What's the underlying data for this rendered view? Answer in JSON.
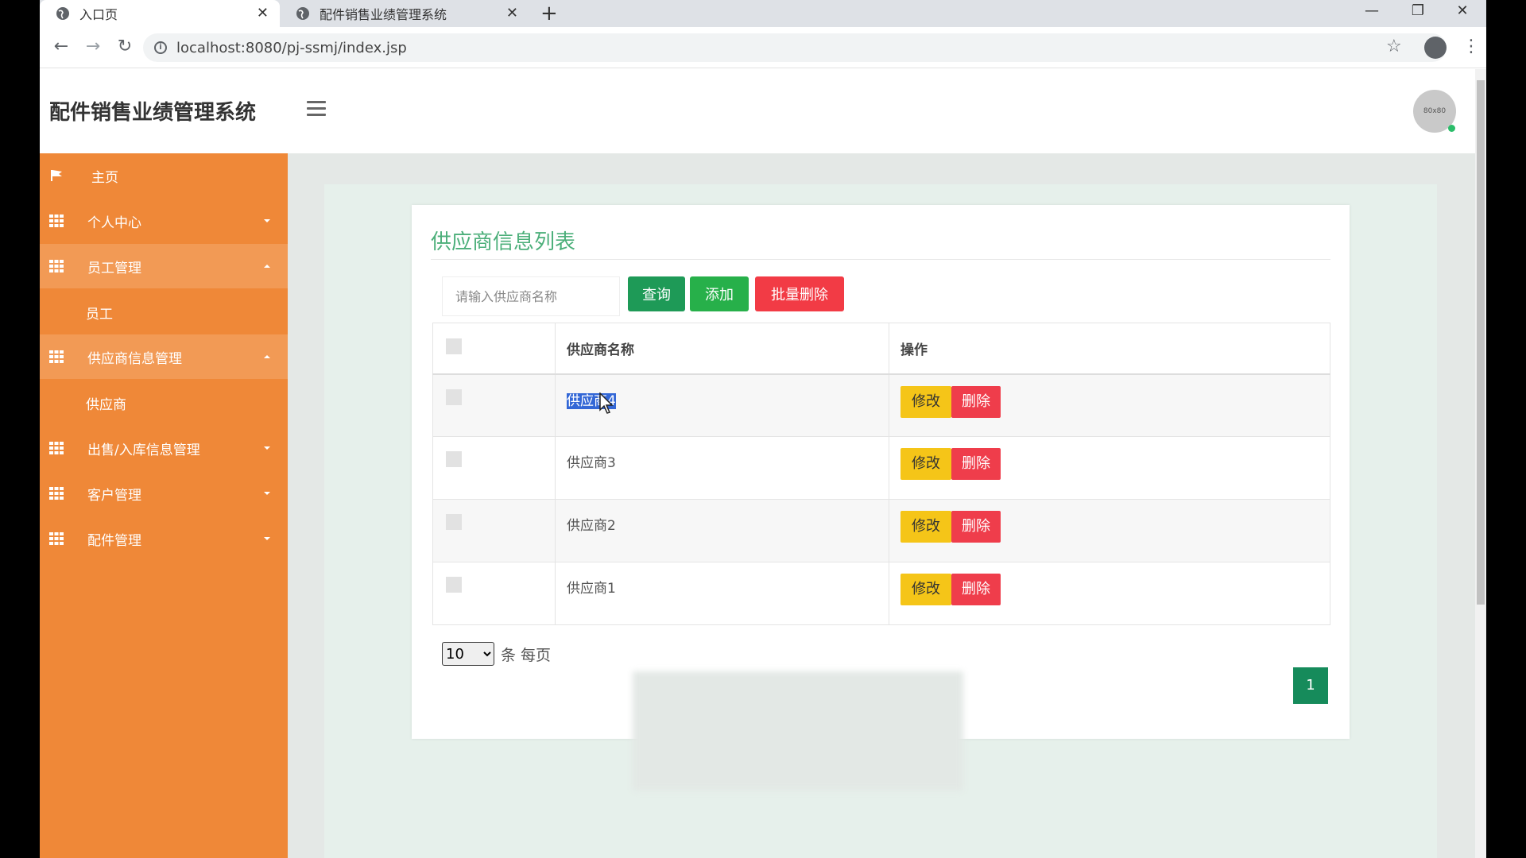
{
  "browser": {
    "tabs": [
      {
        "title": "入口页",
        "active": true
      },
      {
        "title": "配件销售业绩管理系统",
        "active": false
      }
    ],
    "url": "localhost:8080/pj-ssmj/index.jsp"
  },
  "app": {
    "title": "配件销售业绩管理系统",
    "avatar_text": "80x80"
  },
  "sidebar": {
    "items": [
      {
        "label": "主页"
      },
      {
        "label": "个人中心"
      },
      {
        "label": "员工管理",
        "children": [
          "员工"
        ]
      },
      {
        "label": "供应商信息管理",
        "children": [
          "供应商"
        ]
      },
      {
        "label": "出售/入库信息管理"
      },
      {
        "label": "客户管理"
      },
      {
        "label": "配件管理"
      }
    ]
  },
  "main": {
    "title": "供应商信息列表",
    "search_placeholder": "请输入供应商名称",
    "buttons": {
      "query": "查询",
      "add": "添加",
      "batch_delete": "批量删除"
    },
    "table": {
      "columns": [
        "供应商名称",
        "操作"
      ],
      "rows": [
        {
          "name": "供应商4",
          "selected": true
        },
        {
          "name": "供应商3"
        },
        {
          "name": "供应商2"
        },
        {
          "name": "供应商1"
        }
      ],
      "edit_label": "修改",
      "delete_label": "删除"
    },
    "page_size": "10",
    "page_size_unit": "条 每页",
    "current_page": "1"
  },
  "colors": {
    "sidebar": "#ef8838",
    "title_green": "#4caf7a",
    "query": "#1e9a57",
    "add": "#27b04a",
    "danger": "#f23b45",
    "edit": "#f5c518",
    "pager": "#168b5b"
  }
}
